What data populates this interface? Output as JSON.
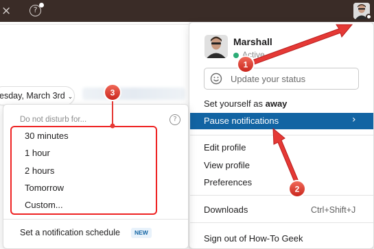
{
  "topbar": {
    "close_icon": "×",
    "help_icon": "?"
  },
  "channel": {
    "date_pill": "esday, March 3rd",
    "date_chevron": "⌄"
  },
  "menu": {
    "profile_name": "Marshall",
    "status_text": "Active",
    "status_placeholder": "Update your status",
    "away_prefix": "Set yourself as ",
    "away_bold": "away",
    "pause_label": "Pause notifications",
    "pause_arrow": "›",
    "edit_profile": "Edit profile",
    "view_profile": "View profile",
    "preferences": "Preferences",
    "downloads": "Downloads",
    "downloads_shortcut": "Ctrl+Shift+J",
    "sign_out": "Sign out of How-To Geek"
  },
  "dnd": {
    "heading": "Do not disturb for...",
    "help_icon": "?",
    "options": [
      "30 minutes",
      "1 hour",
      "2 hours",
      "Tomorrow",
      "Custom..."
    ],
    "schedule_label": "Set a notification schedule",
    "new_badge": "NEW"
  },
  "annotations": {
    "labels": [
      "1",
      "2",
      "3"
    ],
    "color": "#e53935"
  },
  "colors": {
    "topbar": "#3a2c27",
    "highlight": "#1264a3",
    "active": "#2bac76"
  }
}
